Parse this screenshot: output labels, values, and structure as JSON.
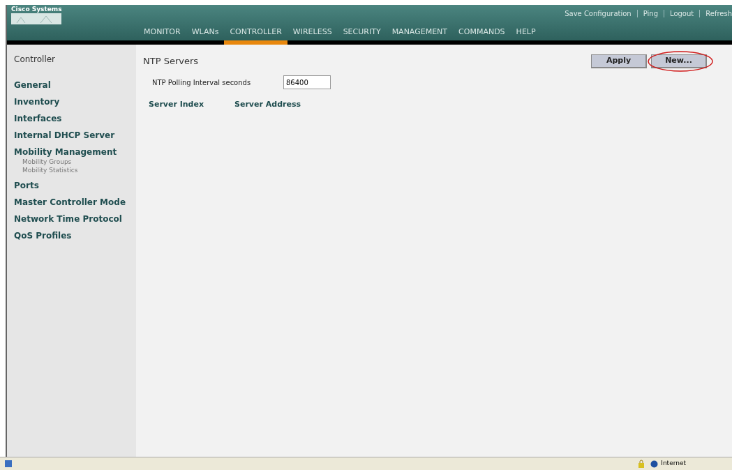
{
  "header": {
    "logo": "Cisco Systems",
    "links": [
      "Save Configuration",
      "Ping",
      "Logout",
      "Refresh"
    ],
    "tabs": [
      {
        "label": "MONITOR",
        "selected": false
      },
      {
        "label": "WLANs",
        "selected": false
      },
      {
        "label": "CONTROLLER",
        "selected": true
      },
      {
        "label": "WIRELESS",
        "selected": false
      },
      {
        "label": "SECURITY",
        "selected": false
      },
      {
        "label": "MANAGEMENT",
        "selected": false
      },
      {
        "label": "COMMANDS",
        "selected": false
      },
      {
        "label": "HELP",
        "selected": false
      }
    ]
  },
  "sidebar": {
    "title": "Controller",
    "items": [
      {
        "label": "General"
      },
      {
        "label": "Inventory"
      },
      {
        "label": "Interfaces"
      },
      {
        "label": "Internal DHCP Server"
      },
      {
        "label": "Mobility Management",
        "children": [
          {
            "label": "Mobility Groups"
          },
          {
            "label": "Mobility Statistics"
          }
        ]
      },
      {
        "label": "Ports"
      },
      {
        "label": "Master Controller Mode"
      },
      {
        "label": "Network Time Protocol"
      },
      {
        "label": "QoS Profiles"
      }
    ]
  },
  "content": {
    "title": "NTP Servers",
    "buttons": [
      "Apply",
      "New..."
    ],
    "field": {
      "label": "NTP Polling Interval seconds",
      "value": "86400"
    },
    "table": {
      "columns": [
        "Server Index",
        "Server Address"
      ]
    }
  },
  "status_bar": {
    "zone": "Internet"
  }
}
